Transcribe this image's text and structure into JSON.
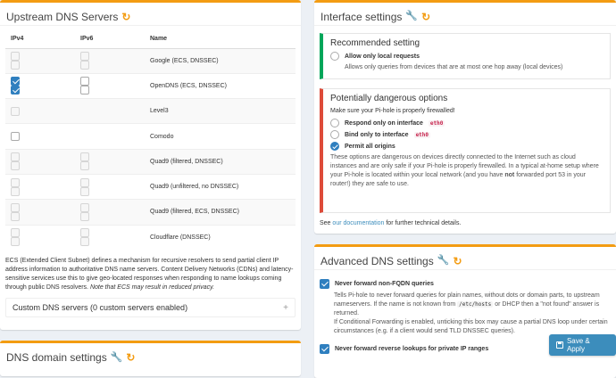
{
  "upstream": {
    "title": "Upstream DNS Servers",
    "columns": {
      "ipv4": "IPv4",
      "ipv6": "IPv6",
      "name": "Name"
    },
    "rows": [
      {
        "name": "Google (ECS, DNSSEC)",
        "v4": [
          false,
          false
        ],
        "v6": [
          false,
          false
        ],
        "dim": true
      },
      {
        "name": "OpenDNS (ECS, DNSSEC)",
        "v4": [
          true,
          true
        ],
        "v6": [
          false,
          false
        ],
        "dim": false
      },
      {
        "name": "Level3",
        "v4": [
          false
        ],
        "v6": [],
        "dim": true
      },
      {
        "name": "Comodo",
        "v4": [
          false
        ],
        "v6": [],
        "dim": false
      },
      {
        "name": "Quad9 (filtered, DNSSEC)",
        "v4": [
          false,
          false
        ],
        "v6": [
          false,
          false
        ],
        "dim": true
      },
      {
        "name": "Quad9 (unfiltered, no DNSSEC)",
        "v4": [
          false,
          false
        ],
        "v6": [
          false,
          false
        ],
        "dim": true
      },
      {
        "name": "Quad9 (filtered, ECS, DNSSEC)",
        "v4": [
          false,
          false
        ],
        "v6": [
          false,
          false
        ],
        "dim": true
      },
      {
        "name": "Cloudflare (DNSSEC)",
        "v4": [
          false,
          false
        ],
        "v6": [
          false,
          false
        ],
        "dim": true
      }
    ],
    "ecs_text": "ECS (Extended Client Subnet) defines a mechanism for recursive resolvers to send partial client IP address information to authoritative DNS name servers. Content Delivery Networks (CDNs) and latency-sensitive services use this to give geo-located responses when responding to name lookups coming through public DNS resolvers.",
    "ecs_note": "Note that ECS may result in reduced privacy.",
    "custom_label": "Custom DNS servers (0 custom servers enabled)",
    "custom_toggle": "+"
  },
  "domain": {
    "title": "DNS domain settings"
  },
  "interface": {
    "title": "Interface settings",
    "recommended": {
      "heading": "Recommended setting",
      "option_label": "Allow only local requests",
      "option_desc": "Allows only queries from devices that are at most one hop away (local devices)",
      "color": "#00a65a"
    },
    "danger": {
      "heading": "Potentially dangerous options",
      "subheading": "Make sure your Pi-hole is properly firewalled!",
      "opt1": "Respond only on interface",
      "opt1_iface": "eth0",
      "opt2": "Bind only to interface",
      "opt2_iface": "eth0",
      "opt3": "Permit all origins",
      "warning_a": "These options are dangerous on devices directly connected to the Internet such as cloud instances and are only safe if your Pi-hole is properly firewalled. In a typical at-home setup where your Pi-hole is located within your local network (and you have",
      "warning_not": "not",
      "warning_b": "forwarded port 53 in your router!) they are safe to use.",
      "color": "#dd4b39"
    },
    "see_pre": "See",
    "see_link": "our documentation",
    "see_post": "for further technical details."
  },
  "advanced": {
    "title": "Advanced DNS settings",
    "fqdn_label": "Never forward non-FQDN queries",
    "fqdn_desc1a": "Tells Pi-hole to never forward queries for plain names, without dots or domain parts, to upstream nameservers. If the name is not known from",
    "fqdn_hosts": "/etc/hosts",
    "fqdn_desc1b": "or DHCP then a \"not found\" answer is returned.",
    "fqdn_desc2": "If Conditional Forwarding is enabled, unticking this box may cause a partial DNS loop under certain circumstances (e.g. if a client would send TLD DNSSEC queries).",
    "reverse_label": "Never forward reverse lookups for private IP ranges"
  },
  "save_label": "Save & Apply",
  "accent": "#f39c12"
}
